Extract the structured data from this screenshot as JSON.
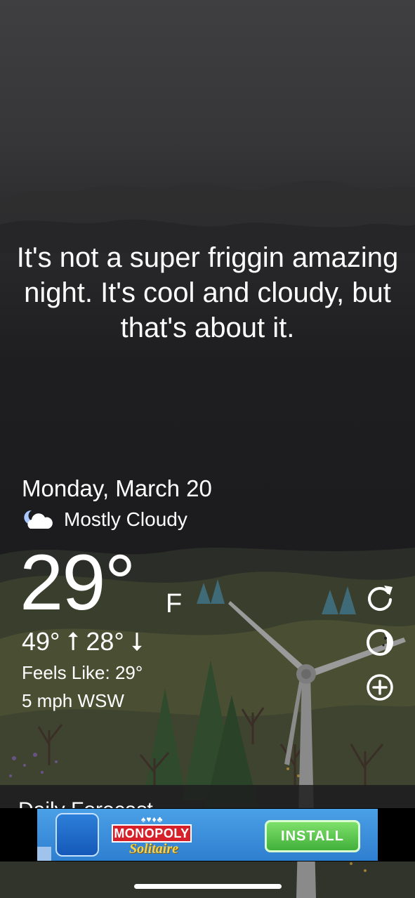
{
  "quote": "It's not a super friggin amazing night. It's cool and cloudy, but that's about it.",
  "weather": {
    "date": "Monday, March 20",
    "condition_icon": "partly-cloudy-night-icon",
    "condition": "Mostly Cloudy",
    "temperature": "29°",
    "unit": "F",
    "high_low": "49° ⭡ 28° ⭣",
    "feels_like": "Feels Like: 29°",
    "wind": "5 mph WSW"
  },
  "side_actions": [
    {
      "name": "refresh",
      "icon": "refresh-icon"
    },
    {
      "name": "moon-phase",
      "icon": "moon-phase-icon"
    },
    {
      "name": "add-location",
      "icon": "add-circle-icon"
    }
  ],
  "forecast_header": "Daily Forecast",
  "ad": {
    "brand": "MONOPOLY",
    "product": "Solitaire",
    "cta": "INSTALL",
    "icon": "monopoly-solitaire-app-icon",
    "ad_choices_icon": "ad-choices-icon"
  },
  "colors": {
    "background": "#1d1d1f",
    "text": "#ffffff",
    "ad_background": "#3a8fd8",
    "install_button": "#5cc84f",
    "brand_red": "#d6212a"
  }
}
